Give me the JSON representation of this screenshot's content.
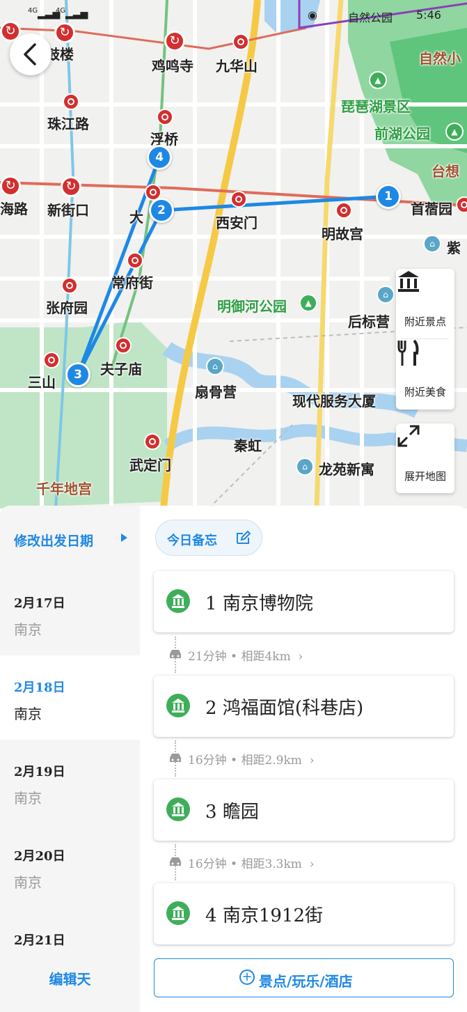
{
  "status_bar": {
    "network": "4G",
    "app_text": "自然公园",
    "time": "5:46"
  },
  "map": {
    "labels": {
      "gulou": "鼓楼",
      "jimingsi": "鸡鸣寺",
      "jiuhuashan": "九华山",
      "zhujianglu": "珠江路",
      "fuqiao": "浮桥",
      "pipahu": "琵琶湖景区",
      "qianhu": "前湖公园",
      "tai": "台想",
      "ziran": "自然小",
      "hailu": "海路",
      "xinjiekou": "新街口",
      "da": "大",
      "xianmen": "西安门",
      "minggugong": "明故宫",
      "shouxu": "首蓿园",
      "chang": "常府街",
      "mingyuhe": "明御河公园",
      "houbiaoying": "后标营",
      "zhangfuyuan": "张府园",
      "fuzimiao": "夫子庙",
      "sanshan": "三山",
      "qiaoying": "扇骨营",
      "xiandai": "现代服务大厦",
      "qinhong": "秦虹",
      "longyuan": "龙苑新寓",
      "wudingmen": "武定门",
      "qiannian": "千年地宫",
      "zi": "紫"
    },
    "pins": [
      "1",
      "2",
      "3",
      "4"
    ],
    "route_color": "#1e88e5"
  },
  "side_buttons": {
    "nearby_sights": "附近景点",
    "nearby_food": "附近美食",
    "expand_map": "展开地图"
  },
  "panel": {
    "modify_date": "修改出发日期",
    "memo": "今日备忘",
    "edit_day": "编辑天",
    "add_button": "景点/玩乐/酒店",
    "days": [
      {
        "date": "2月17日",
        "city": "南京"
      },
      {
        "date": "2月18日",
        "city": "南京",
        "selected": true
      },
      {
        "date": "2月19日",
        "city": "南京"
      },
      {
        "date": "2月20日",
        "city": "南京"
      },
      {
        "date": "2月21日",
        "city": ""
      }
    ],
    "stops": [
      {
        "index": "1",
        "name": "南京博物院"
      },
      {
        "index": "2",
        "name": "鸿福面馆(科巷店)"
      },
      {
        "index": "3",
        "name": "瞻园"
      },
      {
        "index": "4",
        "name": "南京1912街"
      }
    ],
    "segments": [
      "21分钟 • 相距4km",
      "16分钟 • 相距2.9km",
      "16分钟 • 相距3.3km"
    ]
  }
}
